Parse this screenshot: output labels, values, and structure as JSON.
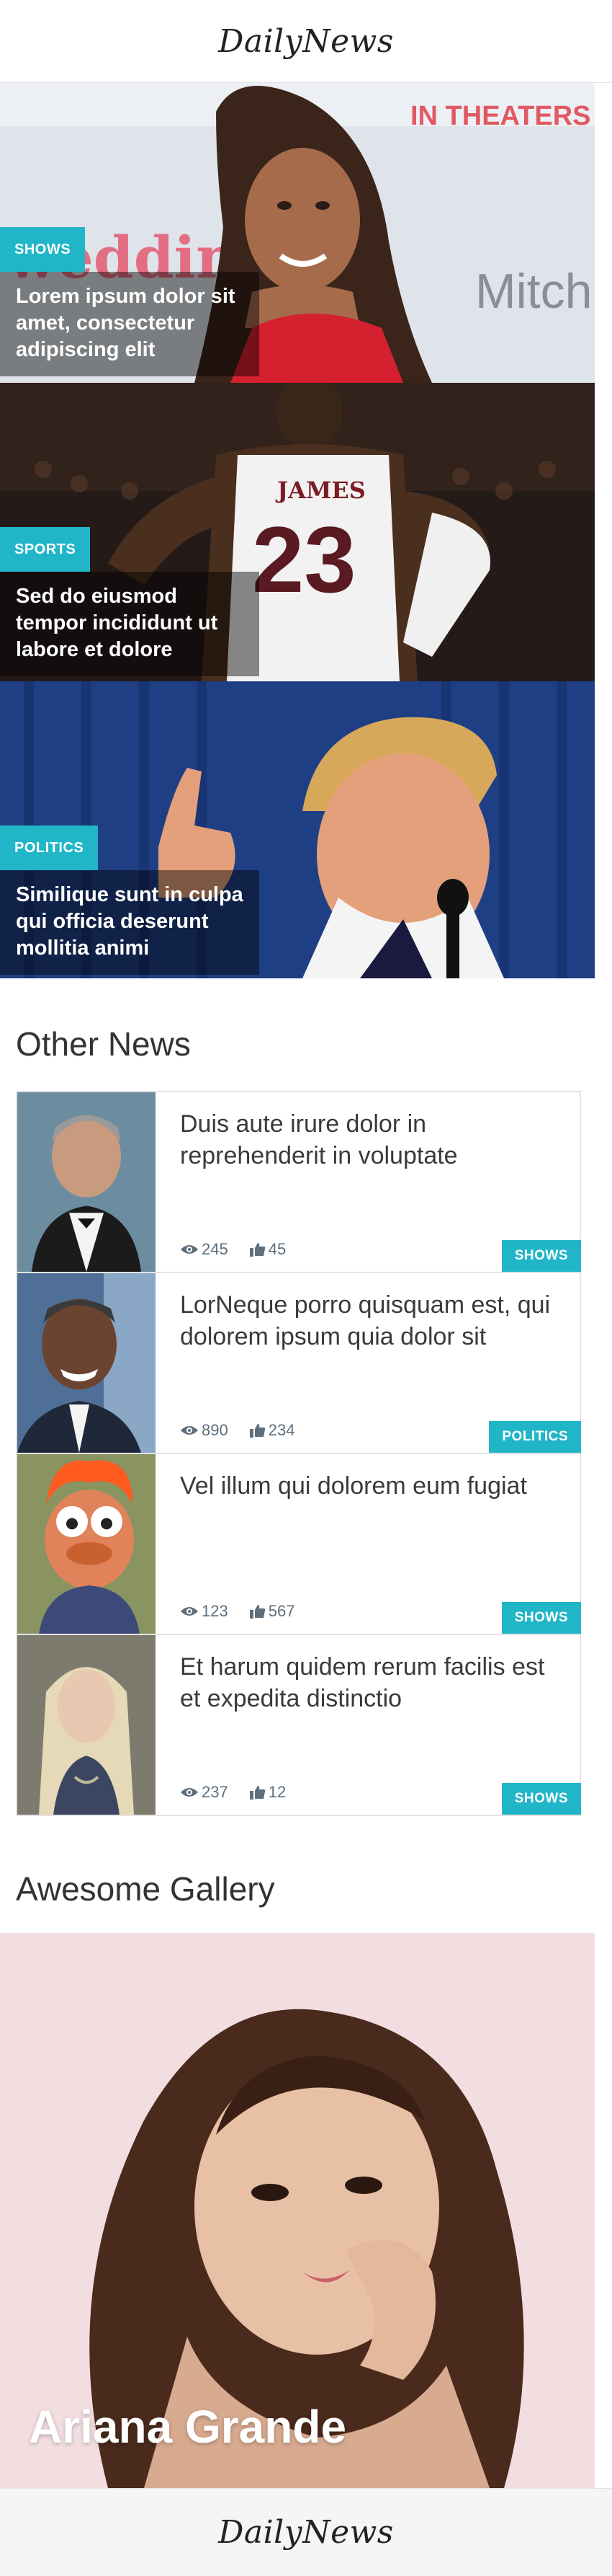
{
  "header": {
    "brand": "DailyNews"
  },
  "heroes": [
    {
      "category": "SHOWS",
      "title": "Lorem ipsum dolor sit amet, consectetur adipiscing elit",
      "sign_text": "IN THEATERS",
      "sign_text_2": "Mitch"
    },
    {
      "category": "SPORTS",
      "title": "Sed do eiusmod tempor incididunt ut labore et dolore",
      "jersey_name": "JAMES",
      "jersey_number": "23"
    },
    {
      "category": "POLITICS",
      "title": "Similique sunt in culpa qui officia deserunt mollitia animi"
    }
  ],
  "other_news": {
    "title": "Other News",
    "items": [
      {
        "headline": "Duis aute irure dolor in reprehenderit in voluptate",
        "views": "245",
        "likes": "45",
        "category": "SHOWS"
      },
      {
        "headline": "LorNeque porro quisquam est, qui dolorem ipsum quia dolor sit",
        "views": "890",
        "likes": "234",
        "category": "POLITICS"
      },
      {
        "headline": "Vel illum qui dolorem eum fugiat",
        "views": "123",
        "likes": "567",
        "category": "SHOWS"
      },
      {
        "headline": "Et harum quidem rerum facilis est et expedita distinctio",
        "views": "237",
        "likes": "12",
        "category": "SHOWS"
      }
    ]
  },
  "gallery": {
    "title": "Awesome Gallery",
    "caption": "Ariana Grande"
  },
  "footer": {
    "brand": "DailyNews"
  },
  "colors": {
    "accent": "#21b5c8"
  },
  "icons": {
    "views": "eye-icon",
    "likes": "thumbs-up-icon"
  }
}
